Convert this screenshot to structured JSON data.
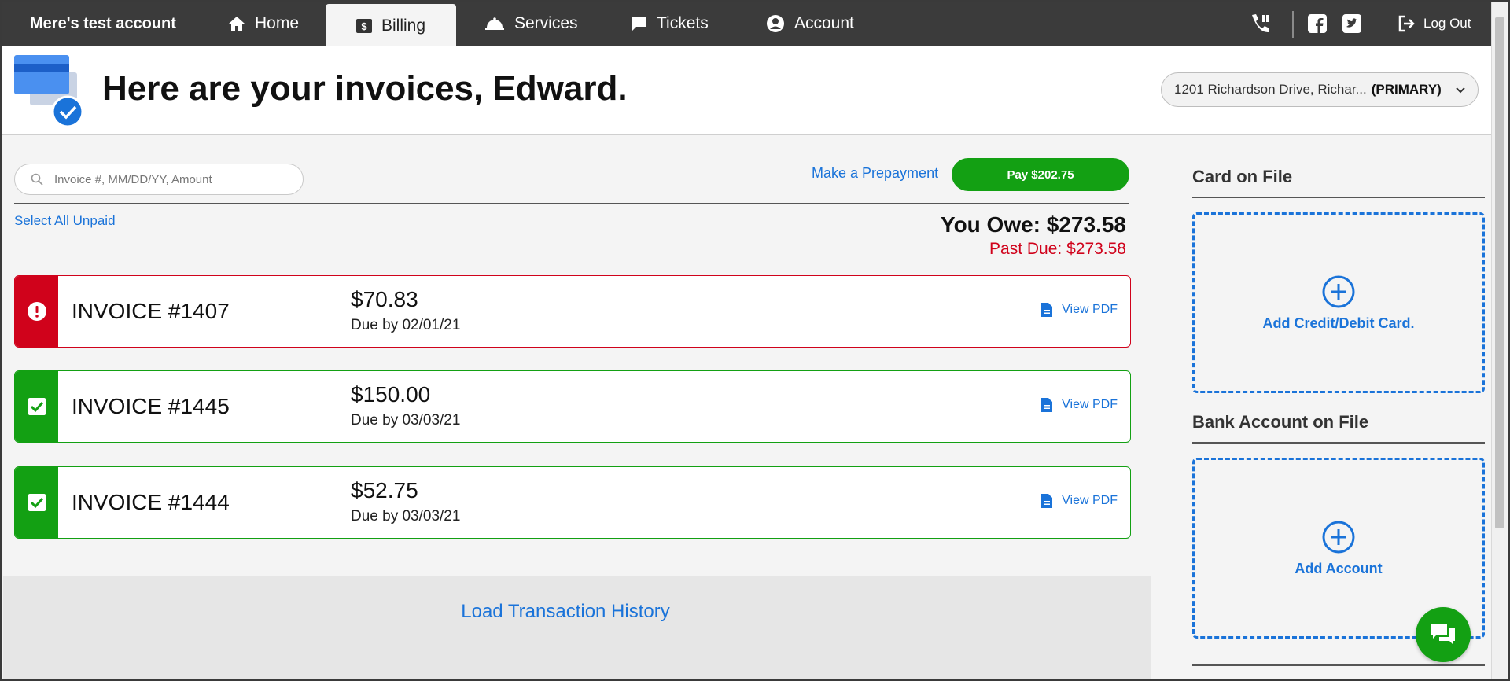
{
  "nav": {
    "brand": "Mere's test account",
    "home": "Home",
    "billing": "Billing",
    "services": "Services",
    "tickets": "Tickets",
    "account": "Account",
    "logout": "Log Out"
  },
  "header": {
    "title": "Here are your invoices, Edward.",
    "address": "1201 Richardson Drive, Richar...",
    "address_tag": "(PRIMARY)"
  },
  "billing": {
    "search_placeholder": "Invoice #, MM/DD/YY, Amount",
    "prepay_label": "Make a Prepayment",
    "pay_label": "Pay $202.75",
    "select_all": "Select All Unpaid",
    "you_owe": "You Owe: $273.58",
    "past_due": "Past Due: $273.58"
  },
  "invoices": [
    {
      "number": "INVOICE #1407",
      "amount": "$70.83",
      "due": "Due by 02/01/21",
      "pdf": "View PDF",
      "status": "past-due",
      "selected": false
    },
    {
      "number": "INVOICE #1445",
      "amount": "$150.00",
      "due": "Due by 03/03/21",
      "pdf": "View PDF",
      "status": "selected",
      "selected": true
    },
    {
      "number": "INVOICE #1444",
      "amount": "$52.75",
      "due": "Due by 03/03/21",
      "pdf": "View PDF",
      "status": "selected",
      "selected": true
    }
  ],
  "history": {
    "label": "Load Transaction History"
  },
  "sidebar": {
    "card_title": "Card on File",
    "card_add": "Add Credit/Debit Card.",
    "bank_title": "Bank Account on File",
    "bank_add": "Add Account"
  },
  "colors": {
    "nav_bg": "#3b3b3b",
    "accent_blue": "#1a73d9",
    "success_green": "#13a013",
    "danger_red": "#d0021b"
  },
  "icons": [
    "home-icon",
    "billing-icon",
    "services-icon",
    "tickets-icon",
    "account-icon",
    "phone-icon",
    "facebook-icon",
    "twitter-icon",
    "logout-icon",
    "search-icon",
    "pdf-icon",
    "chat-icon"
  ]
}
